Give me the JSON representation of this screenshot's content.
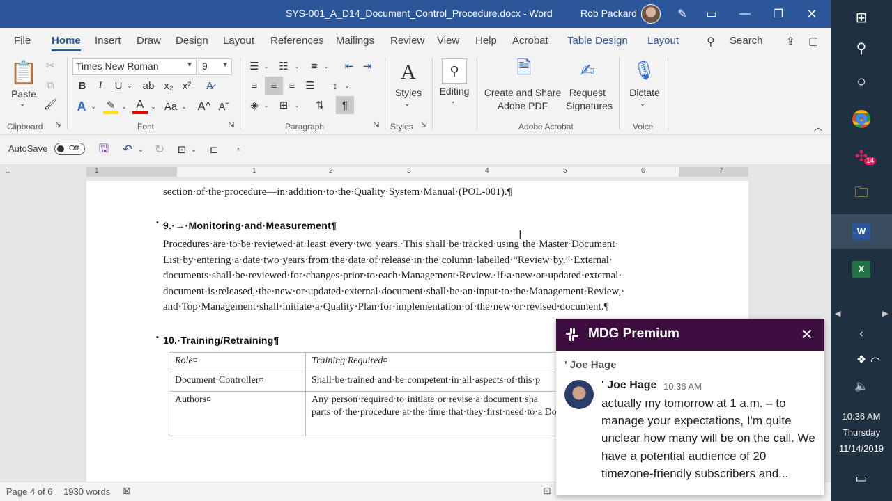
{
  "titlebar": {
    "doc_title": "SYS-001_A_D14_Document_Control_Procedure.docx  -  Word",
    "user_name": "Rob Packard"
  },
  "tabs": [
    "File",
    "Home",
    "Insert",
    "Draw",
    "Design",
    "Layout",
    "References",
    "Mailings",
    "Review",
    "View",
    "Help",
    "Acrobat",
    "Table Design",
    "Layout"
  ],
  "search_label": "Search",
  "ribbon": {
    "paste_label": "Paste",
    "font_name": "Times New Roman",
    "font_size": "9",
    "styles_label": "Styles",
    "editing_label": "Editing",
    "create_pdf_label": "Create and Share Adobe PDF",
    "request_sig_label": "Request Signatures",
    "dictate_label": "Dictate",
    "groups": {
      "clipboard": "Clipboard",
      "font": "Font",
      "paragraph": "Paragraph",
      "styles": "Styles",
      "acrobat": "Adobe Acrobat",
      "voice": "Voice"
    }
  },
  "qat": {
    "autosave_label": "AutoSave",
    "autosave_state": "Off"
  },
  "ruler_numbers": [
    "1",
    "1",
    "2",
    "3",
    "4",
    "5",
    "6",
    "7"
  ],
  "document": {
    "top_line": "section·of·the·procedure—in·addition·to·the·Quality·System·Manual·(POL-001).¶",
    "h9": "9.·→·Monitoring·and·Measurement¶",
    "para9": "Procedures·are·to·be·reviewed·at·least·every·two·years.·This·shall·be·tracked·using·the·Master·Document· List·by·entering·a·date·two·years·from·the·date·of·release·in·the·column·labelled·“Review·by.”·External· documents·shall·be·reviewed·for·changes·prior·to·each·Management·Review.·If·a·new·or·updated·external· document·is·released,·the·new·or·updated·external·document·shall·be·an·input·to·the·Management·Review,· and·Top·Management·shall·initiate·a·Quality·Plan·for·implementation·of·the·new·or·revised·document.¶",
    "h10": "10.·Training/Retraining¶",
    "table": {
      "headers": [
        "Role¤",
        "Training·Required¤"
      ],
      "rows": [
        [
          "Document·Controller¤",
          "Shall·be·trained·and·be·competent·in·all·aspects·of·this·p"
        ],
        [
          "Authors¤",
          "Any·person·required·to·initiate·or·revise·a·document·sha parts·of·the·procedure·at·the·time·that·they·first·need·to·a Document·Controller.¤"
        ]
      ]
    }
  },
  "status": {
    "page": "Page 4 of 6",
    "words": "1930 words"
  },
  "slack": {
    "workspace": "MDG Premium",
    "thread_from": "' Joe Hage",
    "sender": "' Joe Hage",
    "time": "10:36 AM",
    "message": "actually my tomorrow at 1 a.m. – to manage your expectations, I'm quite unclear how many will be on the call. We have a potential audience of 20 timezone-friendly subscribers and..."
  },
  "taskbar": {
    "time": "10:36 AM",
    "day": "Thursday",
    "date": "11/14/2019",
    "slack_badge": "14"
  },
  "colors": {
    "word_blue": "#2b579a",
    "slack_purple": "#3f0e40",
    "taskbar": "#1f3040"
  }
}
